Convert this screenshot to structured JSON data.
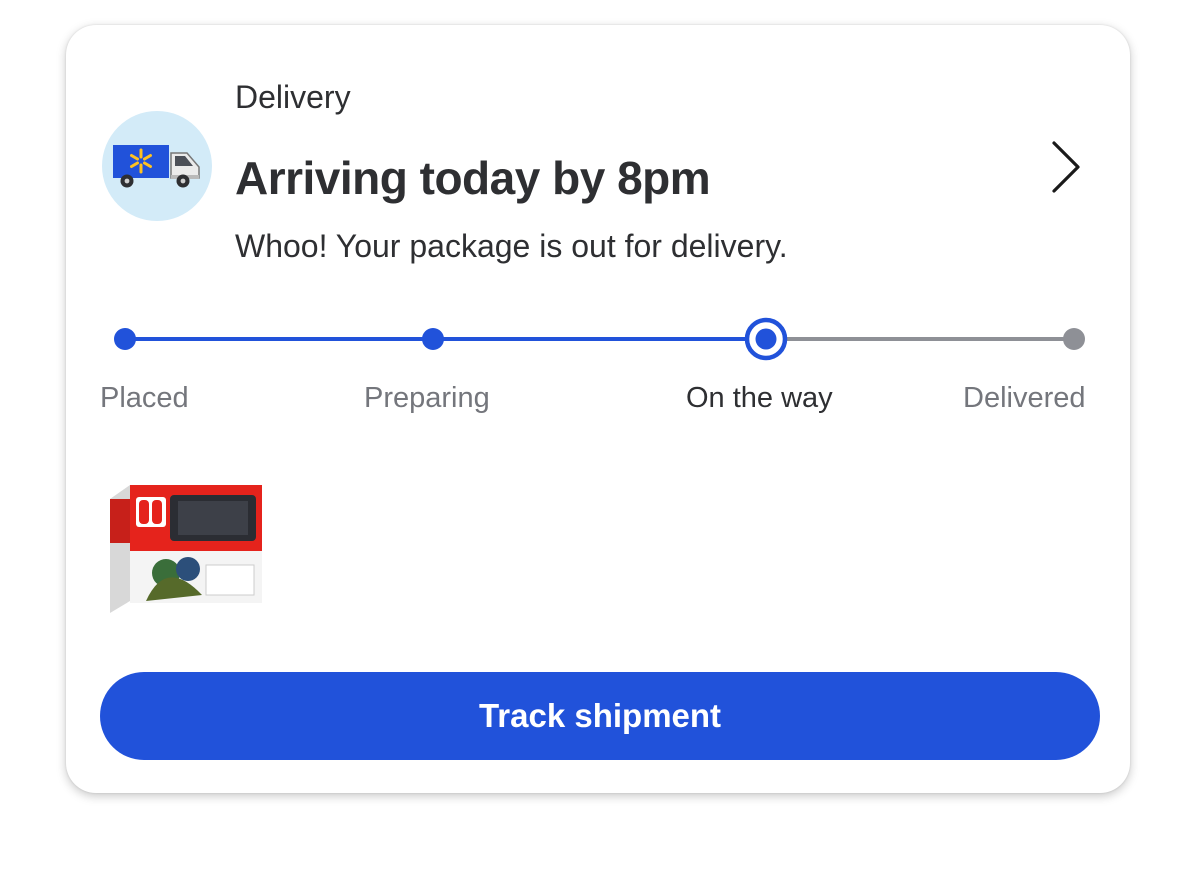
{
  "delivery": {
    "eyebrow": "Delivery",
    "headline": "Arriving today by 8pm",
    "subtext": "Whoo! Your package is out for delivery."
  },
  "progress": {
    "steps": [
      "Placed",
      "Preparing",
      "On the way",
      "Delivered"
    ],
    "current_step_index": 2
  },
  "colors": {
    "accent": "#2152da",
    "inactive": "#8e9096",
    "truck_circle_bg": "#d3ebf8",
    "spark": "#ffc220"
  },
  "icons": {
    "truck": "delivery-truck-icon",
    "chevron": "chevron-right-icon"
  },
  "actions": {
    "track_label": "Track shipment"
  }
}
